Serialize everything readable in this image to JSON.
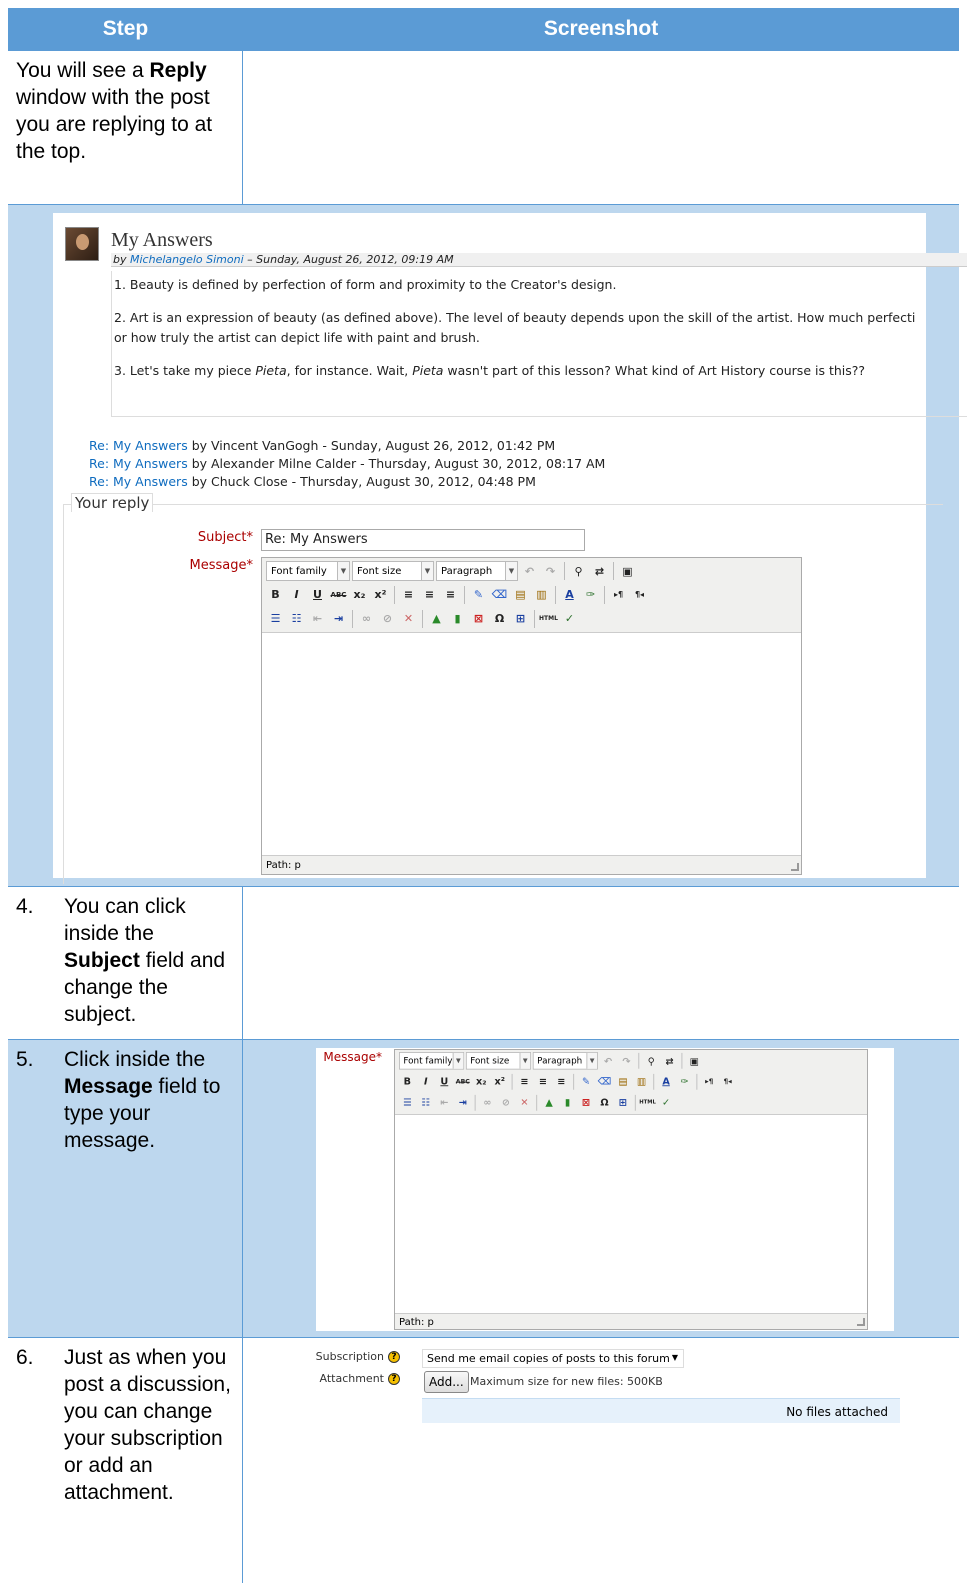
{
  "table": {
    "headers": [
      "Step",
      "Screenshot"
    ]
  },
  "steps": {
    "s1": {
      "pre": "You will see a ",
      "bold": "Reply",
      "post": " window with the post you are replying to at the top."
    },
    "s4": {
      "num": "4.",
      "pre": "You can click inside the ",
      "bold": "Subject",
      "post": " field and change the subject."
    },
    "s5": {
      "num": "5.",
      "pre": "Click inside the ",
      "bold": "Message",
      "post": " field to type your message."
    },
    "s6": {
      "num": "6.",
      "text": "Just as when you post a discussion, you can change your subscription or add an attachment."
    }
  },
  "post": {
    "title": "My Answers",
    "by_prefix": "by ",
    "author": "Michelangelo Simoni",
    "date": " – Sunday, August 26, 2012, 09:19 AM",
    "lines": [
      "1. Beauty is defined by perfection of form and proximity to the Creator's design.",
      "2. Art is an expression of beauty (as defined above). The level of beauty depends upon the skill of the artist. How much perfecti",
      "or how truly the artist can depict life with paint and brush."
    ],
    "line3_a": "3. Let's take my piece ",
    "line3_em1": "Pieta",
    "line3_b": ", for instance. Wait, ",
    "line3_em2": "Pieta",
    "line3_c": " wasn't part of this lesson? What kind of Art History course is this??"
  },
  "replies": [
    {
      "link": "Re: My Answers",
      "rest": " by Vincent VanGogh - Sunday, August 26, 2012, 01:42 PM"
    },
    {
      "link": "Re: My Answers",
      "rest": " by Alexander Milne Calder - Thursday, August 30, 2012, 08:17 AM"
    },
    {
      "link": "Re: My Answers",
      "rest": " by Chuck Close - Thursday, August 30, 2012, 04:48 PM"
    }
  ],
  "form": {
    "legend": "Your reply",
    "subject_label": "Subject",
    "subject_value": "Re: My Answers",
    "message_label": "Message",
    "required_mark": "*",
    "font_family": "Font family",
    "font_size": "Font size",
    "paragraph": "Paragraph",
    "path": "Path: p",
    "subscription_label": "Subscription",
    "subscription_value": "Send me email copies of posts to this forum",
    "attachment_label": "Attachment",
    "add_button": "Add...",
    "max_size": "Maximum size for new files: 500KB",
    "no_files": "No files attached"
  },
  "colors": {
    "header": "#5b9bd5",
    "row_alt": "#bdd7ee",
    "link": "#0f6cbf",
    "required": "#aa0000"
  }
}
